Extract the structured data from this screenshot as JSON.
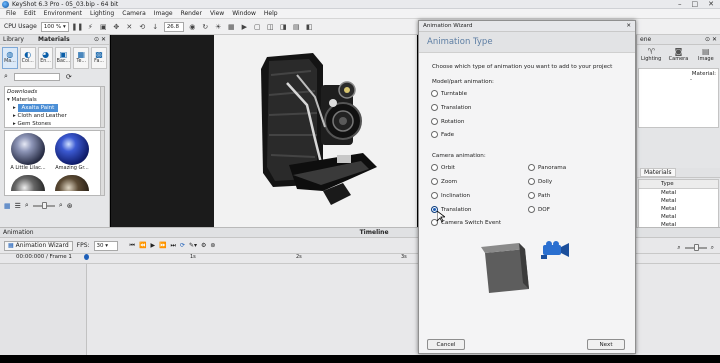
{
  "app": {
    "title": "KeyShot 6.3 Pro - 05_03.bip - 64 bit"
  },
  "menu": [
    "File",
    "Edit",
    "Environment",
    "Lighting",
    "Camera",
    "Image",
    "Render",
    "View",
    "Window",
    "Help"
  ],
  "toolbar": {
    "cpu_label": "CPU Usage",
    "cpu_value": "100 %",
    "zoom_value": "26.8"
  },
  "library": {
    "title": "Library",
    "materials_tab": "Materials",
    "tabs": [
      "Ma...",
      "Col...",
      "En...",
      "Bac...",
      "Te...",
      "Fa..."
    ],
    "tree": [
      "Downloads",
      "Materials",
      "Axalta Paint",
      "Cloth and Leather",
      "Gem Stones"
    ],
    "thumbs": [
      "A Little Lilac...",
      "Amazing Gr...",
      "",
      ""
    ]
  },
  "scene_panel": {
    "title": "ene",
    "buttons": [
      "Lighting",
      "Camera",
      "Image"
    ],
    "material_header": "Material:"
  },
  "material_table": {
    "tab": "Materials",
    "column": "Type",
    "rows": [
      "Metal",
      "Metal",
      "Metal",
      "Metal",
      "Metal"
    ]
  },
  "animation": {
    "panel_title": "Animation",
    "timeline_label": "Timeline",
    "wizard_button": "Animation Wizard",
    "fps_label": "FPS:",
    "fps_value": "30",
    "time_display": "00:00:000 / Frame 1",
    "ruler": [
      "1s",
      "2s",
      "3s"
    ]
  },
  "wizard": {
    "window_title": "Animation Wizard",
    "header": "Animation Type",
    "prompt": "Choose which type of animation you want to add to your project",
    "part_heading": "Model/part animation:",
    "part_options": [
      "Turntable",
      "Translation",
      "Rotation",
      "Fade"
    ],
    "camera_heading": "Camera animation:",
    "camera_left": [
      "Orbit",
      "Zoom",
      "Inclination",
      "Translation",
      "Camera Switch Event"
    ],
    "camera_right": [
      "Panorama",
      "Dolly",
      "Path",
      "DOF"
    ],
    "selected": "Translation",
    "cancel_label": "Cancel",
    "next_label": "Next"
  },
  "colors": {
    "accent": "#1d5fb9",
    "header_text": "#5d7ea3",
    "selection": "#4c8fd6"
  }
}
